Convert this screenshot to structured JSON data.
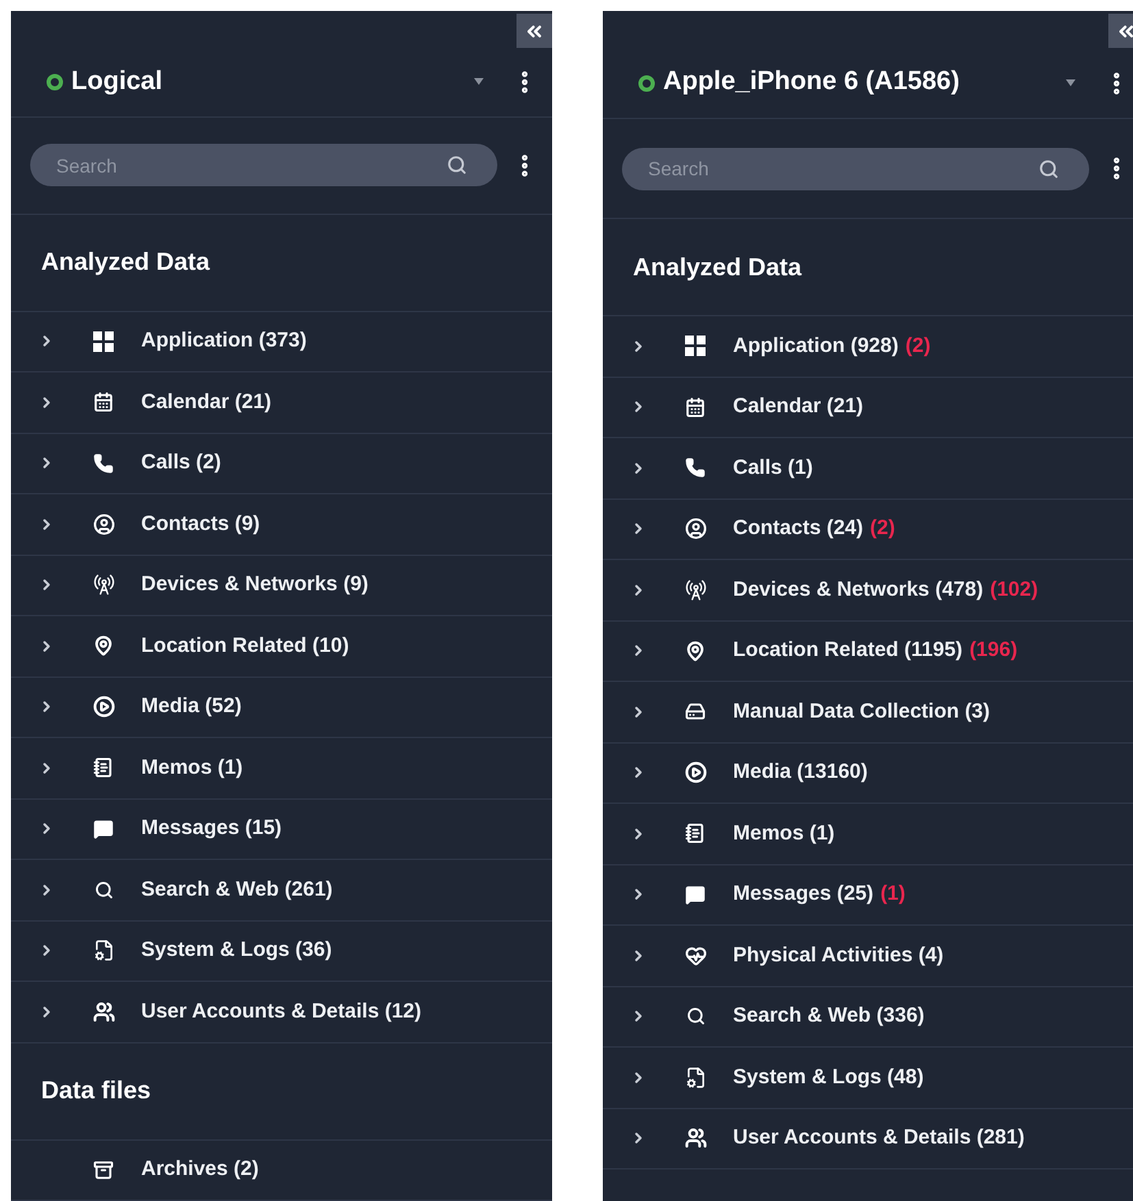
{
  "panels": [
    {
      "title": "Logical",
      "color": "#4caf50",
      "search": {
        "placeholder": "Search"
      },
      "sections": [
        {
          "heading": "Analyzed Data",
          "items": [
            {
              "kind": "apps",
              "label": "Application (373)",
              "expandable": true
            },
            {
              "kind": "calendar",
              "label": "Calendar (21)",
              "expandable": true
            },
            {
              "kind": "calls",
              "label": "Calls (2)",
              "expandable": true
            },
            {
              "kind": "contacts",
              "label": "Contacts (9)",
              "expandable": true
            },
            {
              "kind": "network",
              "label": "Devices & Networks (9)",
              "expandable": true
            },
            {
              "kind": "location",
              "label": "Location Related (10)",
              "expandable": true
            },
            {
              "kind": "media",
              "label": "Media (52)",
              "expandable": true
            },
            {
              "kind": "memos",
              "label": "Memos (1)",
              "expandable": true
            },
            {
              "kind": "messages",
              "label": "Messages (15)",
              "expandable": true
            },
            {
              "kind": "search",
              "label": "Search & Web (261)",
              "expandable": true
            },
            {
              "kind": "system",
              "label": "System & Logs (36)",
              "expandable": true
            },
            {
              "kind": "accounts",
              "label": "User Accounts & Details (12)",
              "expandable": true
            }
          ]
        },
        {
          "heading": "Data files",
          "items": [
            {
              "kind": "archives",
              "label": "Archives (2)",
              "expandable": false
            }
          ]
        }
      ]
    },
    {
      "title": "Apple_iPhone 6 (A1586)",
      "color": "#4caf50",
      "search": {
        "placeholder": "Search"
      },
      "sections": [
        {
          "heading": "Analyzed Data",
          "items": [
            {
              "kind": "apps",
              "label": "Application (928)",
              "flag": "(2)",
              "expandable": true
            },
            {
              "kind": "calendar",
              "label": "Calendar (21)",
              "expandable": true
            },
            {
              "kind": "calls",
              "label": "Calls (1)",
              "expandable": true
            },
            {
              "kind": "contacts",
              "label": "Contacts (24)",
              "flag": "(2)",
              "expandable": true
            },
            {
              "kind": "network",
              "label": "Devices & Networks (478)",
              "flag": "(102)",
              "expandable": true
            },
            {
              "kind": "location",
              "label": "Location Related (1195)",
              "flag": "(196)",
              "expandable": true
            },
            {
              "kind": "collection",
              "label": "Manual Data Collection (3)",
              "expandable": true
            },
            {
              "kind": "media",
              "label": "Media (13160)",
              "expandable": true
            },
            {
              "kind": "memos",
              "label": "Memos (1)",
              "expandable": true
            },
            {
              "kind": "messages",
              "label": "Messages (25)",
              "flag": "(1)",
              "expandable": true
            },
            {
              "kind": "activity",
              "label": "Physical Activities (4)",
              "expandable": true
            },
            {
              "kind": "search",
              "label": "Search & Web (336)",
              "expandable": true
            },
            {
              "kind": "system",
              "label": "System & Logs (48)",
              "expandable": true
            },
            {
              "kind": "accounts",
              "label": "User Accounts & Details (281)",
              "expandable": true
            }
          ]
        }
      ]
    }
  ]
}
